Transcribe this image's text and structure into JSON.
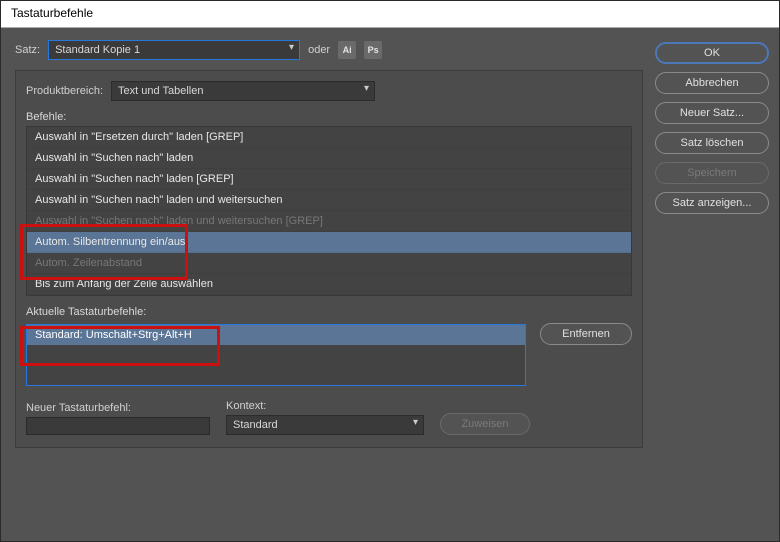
{
  "title": "Tastaturbefehle",
  "satz": {
    "label": "Satz:",
    "value": "Standard Kopie 1",
    "or": "oder"
  },
  "icons": {
    "ai": "Ai",
    "ps": "Ps"
  },
  "area": {
    "label": "Produktbereich:",
    "value": "Text und Tabellen"
  },
  "commands": {
    "label": "Befehle:",
    "items": [
      "Auswahl in \"Ersetzen durch\" laden [GREP]",
      "Auswahl in \"Suchen nach\" laden",
      "Auswahl in \"Suchen nach\" laden [GREP]",
      "Auswahl in \"Suchen nach\" laden und weitersuchen",
      "Auswahl in \"Suchen nach\" laden und weitersuchen [GREP]",
      "Autom. Silbentrennung ein/aus",
      "Autom. Zeilenabstand",
      "Bis zum Anfang der Zeile auswählen"
    ],
    "selected_index": 5
  },
  "current": {
    "label": "Aktuelle Tastaturbefehle:",
    "value": "Standard: Umschalt+Strg+Alt+H",
    "remove": "Entfernen"
  },
  "newshortcut": {
    "label": "Neuer Tastaturbefehl:",
    "value": ""
  },
  "context": {
    "label": "Kontext:",
    "value": "Standard"
  },
  "assign": "Zuweisen",
  "buttons": {
    "ok": "OK",
    "cancel": "Abbrechen",
    "newset": "Neuer Satz...",
    "deleteset": "Satz löschen",
    "save": "Speichern",
    "showset": "Satz anzeigen..."
  }
}
